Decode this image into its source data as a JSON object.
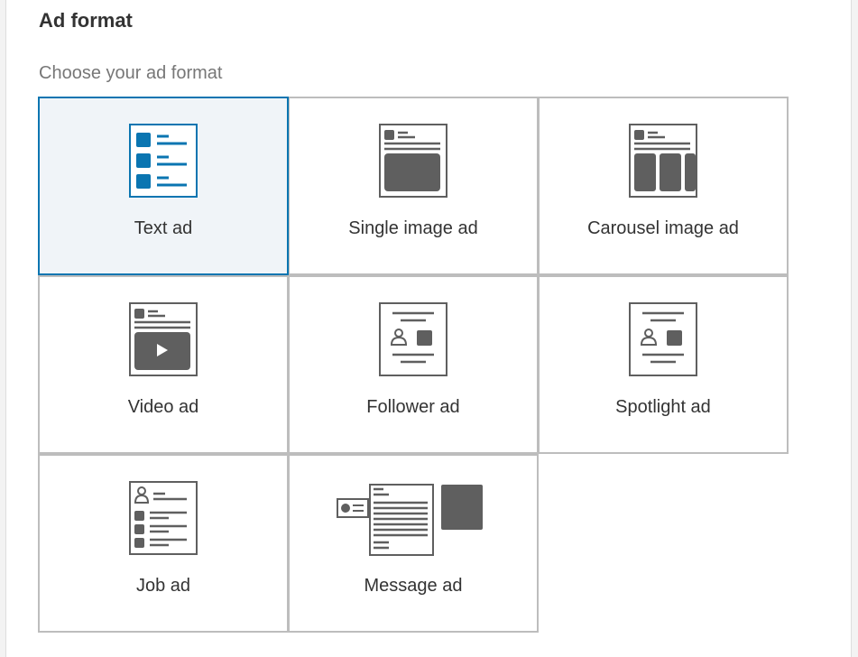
{
  "section": {
    "title": "Ad format",
    "subtitle": "Choose your ad format"
  },
  "formats": [
    {
      "label": "Text ad",
      "icon": "text-ad-icon",
      "selected": true
    },
    {
      "label": "Single image ad",
      "icon": "single-image-ad-icon",
      "selected": false
    },
    {
      "label": "Carousel image ad",
      "icon": "carousel-image-ad-icon",
      "selected": false
    },
    {
      "label": "Video ad",
      "icon": "video-ad-icon",
      "selected": false
    },
    {
      "label": "Follower ad",
      "icon": "follower-ad-icon",
      "selected": false
    },
    {
      "label": "Spotlight ad",
      "icon": "spotlight-ad-icon",
      "selected": false
    },
    {
      "label": "Job ad",
      "icon": "job-ad-icon",
      "selected": false
    },
    {
      "label": "Message ad",
      "icon": "message-ad-icon",
      "selected": false
    }
  ],
  "colors": {
    "accent": "#0a75b1",
    "icon_gray": "#5f5f5f",
    "border": "#bdbdbd",
    "selected_bg": "#f0f4f8"
  }
}
